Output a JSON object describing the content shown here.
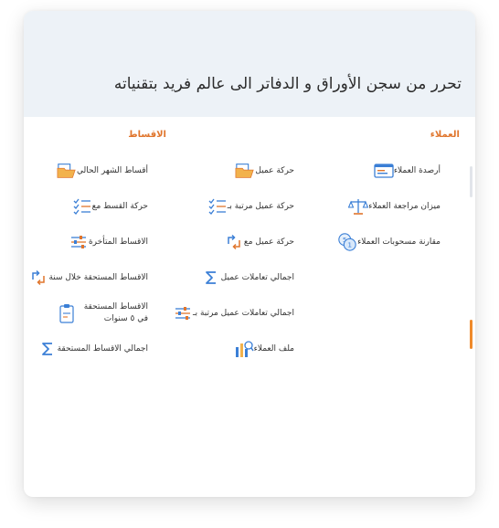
{
  "hero": {
    "title": "تحرر من سجن الأوراق و الدفاتر الى عالم فريد بتقنياته"
  },
  "sections": {
    "customers": {
      "title": "العملاء",
      "items": [
        {
          "label": "أرصدة العملاء",
          "icon": "card-icon"
        },
        {
          "label": "ميزان مراجعة العملاء",
          "icon": "scales-icon"
        },
        {
          "label": "مقارنة مسحوبات العملاء",
          "icon": "coins-icon"
        }
      ]
    },
    "movements": {
      "items": [
        {
          "label": "حركة عميل",
          "icon": "folder-icon"
        },
        {
          "label": "حركة عميل مرتبة بـ",
          "icon": "checklist-icon"
        },
        {
          "label": "حركة عميل مع",
          "icon": "refresh-icon"
        },
        {
          "label": "اجمالي تعاملات عميل",
          "icon": "sigma-icon"
        },
        {
          "label": "اجمالي تعاملات عميل مرتبة بـ",
          "icon": "sliders-icon"
        },
        {
          "label": "ملف العملاء",
          "icon": "chart-search-icon"
        }
      ]
    },
    "installments": {
      "title": "الاقساط",
      "items": [
        {
          "label": "أقساط الشهر الحالي",
          "icon": "folder-icon"
        },
        {
          "label": "حركة القسط مع",
          "icon": "checklist-icon"
        },
        {
          "label": "الاقساط المتأخرة",
          "icon": "sliders-icon"
        },
        {
          "label": "الاقساط المستحقة خلال سنة",
          "icon": "refresh-icon"
        },
        {
          "label": "الاقساط المستحقة في ٥ سنوات",
          "icon": "clipboard-icon"
        },
        {
          "label": "اجمالي الاقساط المستحقة",
          "icon": "sigma-icon"
        }
      ]
    }
  },
  "colors": {
    "accent": "#e0752c",
    "icon_blue": "#3b7fd6",
    "header_bg": "#edf2f7"
  }
}
